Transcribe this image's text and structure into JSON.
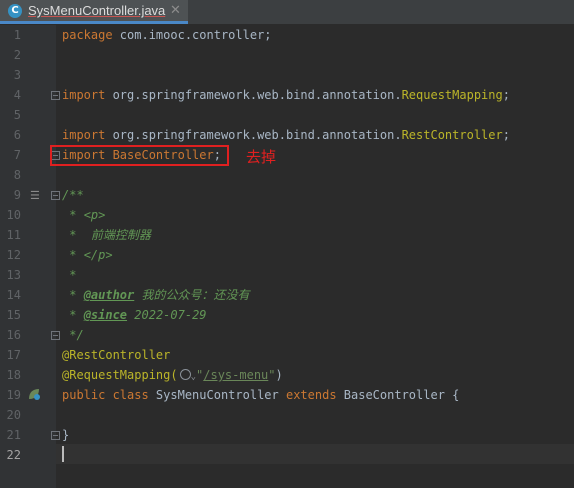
{
  "tab": {
    "title": "SysMenuController.java",
    "icon_letter": "C"
  },
  "annotation": {
    "note": "去掉"
  },
  "gutter": {
    "line_numbers": [
      "1",
      "2",
      "3",
      "4",
      "5",
      "6",
      "7",
      "8",
      "9",
      "10",
      "11",
      "12",
      "13",
      "14",
      "15",
      "16",
      "17",
      "18",
      "19",
      "20",
      "21",
      "22"
    ]
  },
  "code": {
    "l1_kw": "package",
    "l1_rest": " com.imooc.controller;",
    "l4_kw": "import",
    "l4_pkg": " org.springframework.web.bind.annotation.",
    "l4_cls": "RequestMapping",
    "l4_end": ";",
    "l6_kw": "import",
    "l6_pkg": " org.springframework.web.bind.annotation.",
    "l6_cls": "RestController",
    "l6_end": ";",
    "l7_kw": "import",
    "l7_cls": " BaseController",
    "l7_end": ";",
    "l9": "/**",
    "l10_a": " * ",
    "l10_b": "<p>",
    "l11": " *  前端控制器",
    "l12_a": " * ",
    "l12_b": "</p>",
    "l13": " *",
    "l14_a": " * ",
    "l14_tag": "@author",
    "l14_val": " 我的公众号：还没有",
    "l15_a": " * ",
    "l15_tag": "@since",
    "l15_val": " 2022-07-29",
    "l16": " */",
    "l17": "@RestController",
    "l18_ann": "@RequestMapping(",
    "l18_chev": "✓",
    "l18_q1": "\"",
    "l18_path": "/sys-menu",
    "l18_q2": "\"",
    "l18_end": ")",
    "l19_kw1": "public class",
    "l19_name": " SysMenuController ",
    "l19_kw2": "extends",
    "l19_rest": " BaseController {",
    "l21": "}"
  },
  "colors": {
    "keyword": "#cc7832",
    "string": "#6a8759",
    "annotation": "#bbb529",
    "doc": "#629755",
    "highlight": "#e02020"
  }
}
